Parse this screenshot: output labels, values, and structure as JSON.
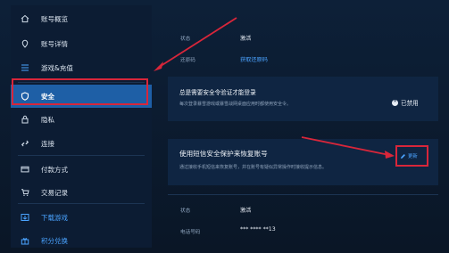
{
  "colors": {
    "background": "#0c1a2e",
    "active": "#1e5fa6",
    "link": "#4aa3ff",
    "annotation": "#d8263a"
  },
  "sidebar": {
    "items": [
      {
        "icon": "home-icon",
        "label": "账号概览"
      },
      {
        "icon": "location-icon",
        "label": "账号详情"
      },
      {
        "icon": "list-icon",
        "label": "游戏&充值"
      },
      {
        "icon": "shield-icon",
        "label": "安全",
        "active": true
      },
      {
        "icon": "lock-icon",
        "label": "隐私"
      },
      {
        "icon": "link-icon",
        "label": "连接"
      },
      {
        "icon": "card-icon",
        "label": "付款方式"
      },
      {
        "icon": "cart-icon",
        "label": "交易记录"
      },
      {
        "icon": "download-icon",
        "label": "下载游戏"
      },
      {
        "icon": "gift-icon",
        "label": "积分兑换"
      }
    ]
  },
  "section1": {
    "status_label": "状态",
    "status_value": "激活",
    "recovery_label": "还原码",
    "recovery_link": "获取还原码"
  },
  "verify": {
    "title": "总是需要安全令验证才能登录",
    "desc": "每次登录暴雪游戏或暴雪战网桌面应用时都使用安全令。",
    "status_text": "已禁用"
  },
  "sms": {
    "title": "使用短信安全保护来恢复账号",
    "desc": "通过接收手机短信来恢复账号，并在账号有疑似异常操作时接收提示信息。",
    "edit_label": "更新",
    "status_label": "状态",
    "status_value": "激活",
    "phone_label": "电话号码",
    "phone_value": "*** **** **13"
  }
}
